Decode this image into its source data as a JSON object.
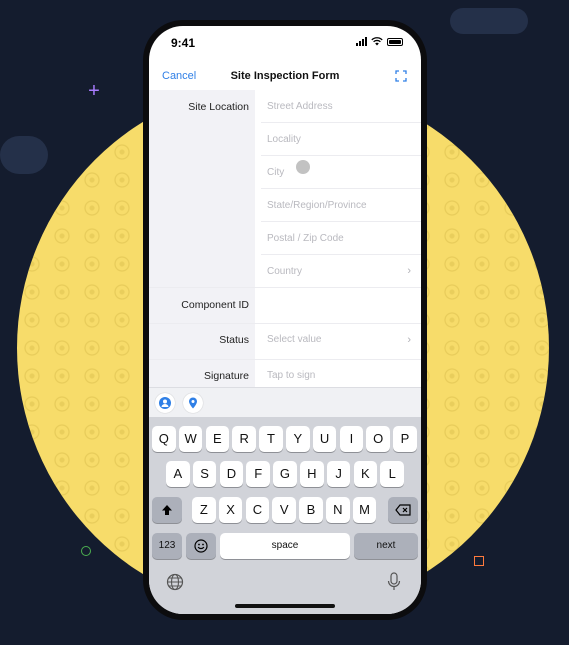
{
  "status_bar": {
    "time": "9:41"
  },
  "nav": {
    "cancel_label": "Cancel",
    "title": "Site Inspection Form",
    "expand_icon": "expand-icon"
  },
  "form": {
    "site_location_label": "Site Location",
    "street_placeholder": "Street Address",
    "locality_placeholder": "Locality",
    "city_placeholder": "City",
    "state_placeholder": "State/Region/Province",
    "postal_placeholder": "Postal / Zip Code",
    "country_placeholder": "Country",
    "component_id_label": "Component ID",
    "component_id_value": "",
    "status_label": "Status",
    "status_placeholder": "Select value",
    "signature_label": "Signature",
    "signature_placeholder": "Tap to sign"
  },
  "accessory": {
    "contact_icon": "contact-icon",
    "location_icon": "location-pin-icon"
  },
  "keyboard": {
    "row1": [
      "Q",
      "W",
      "E",
      "R",
      "T",
      "Y",
      "U",
      "I",
      "O",
      "P"
    ],
    "row2": [
      "A",
      "S",
      "D",
      "F",
      "G",
      "H",
      "J",
      "K",
      "L"
    ],
    "row3": [
      "Z",
      "X",
      "C",
      "V",
      "B",
      "N",
      "M"
    ],
    "numbers_label": "123",
    "space_label": "space",
    "next_label": "next",
    "icons": [
      "shift-icon",
      "backspace-icon",
      "emoji-icon",
      "globe-icon",
      "microphone-icon"
    ]
  },
  "colors": {
    "background": "#141c2e",
    "circle": "#f7dc6a",
    "accent": "#2f7fe6"
  }
}
